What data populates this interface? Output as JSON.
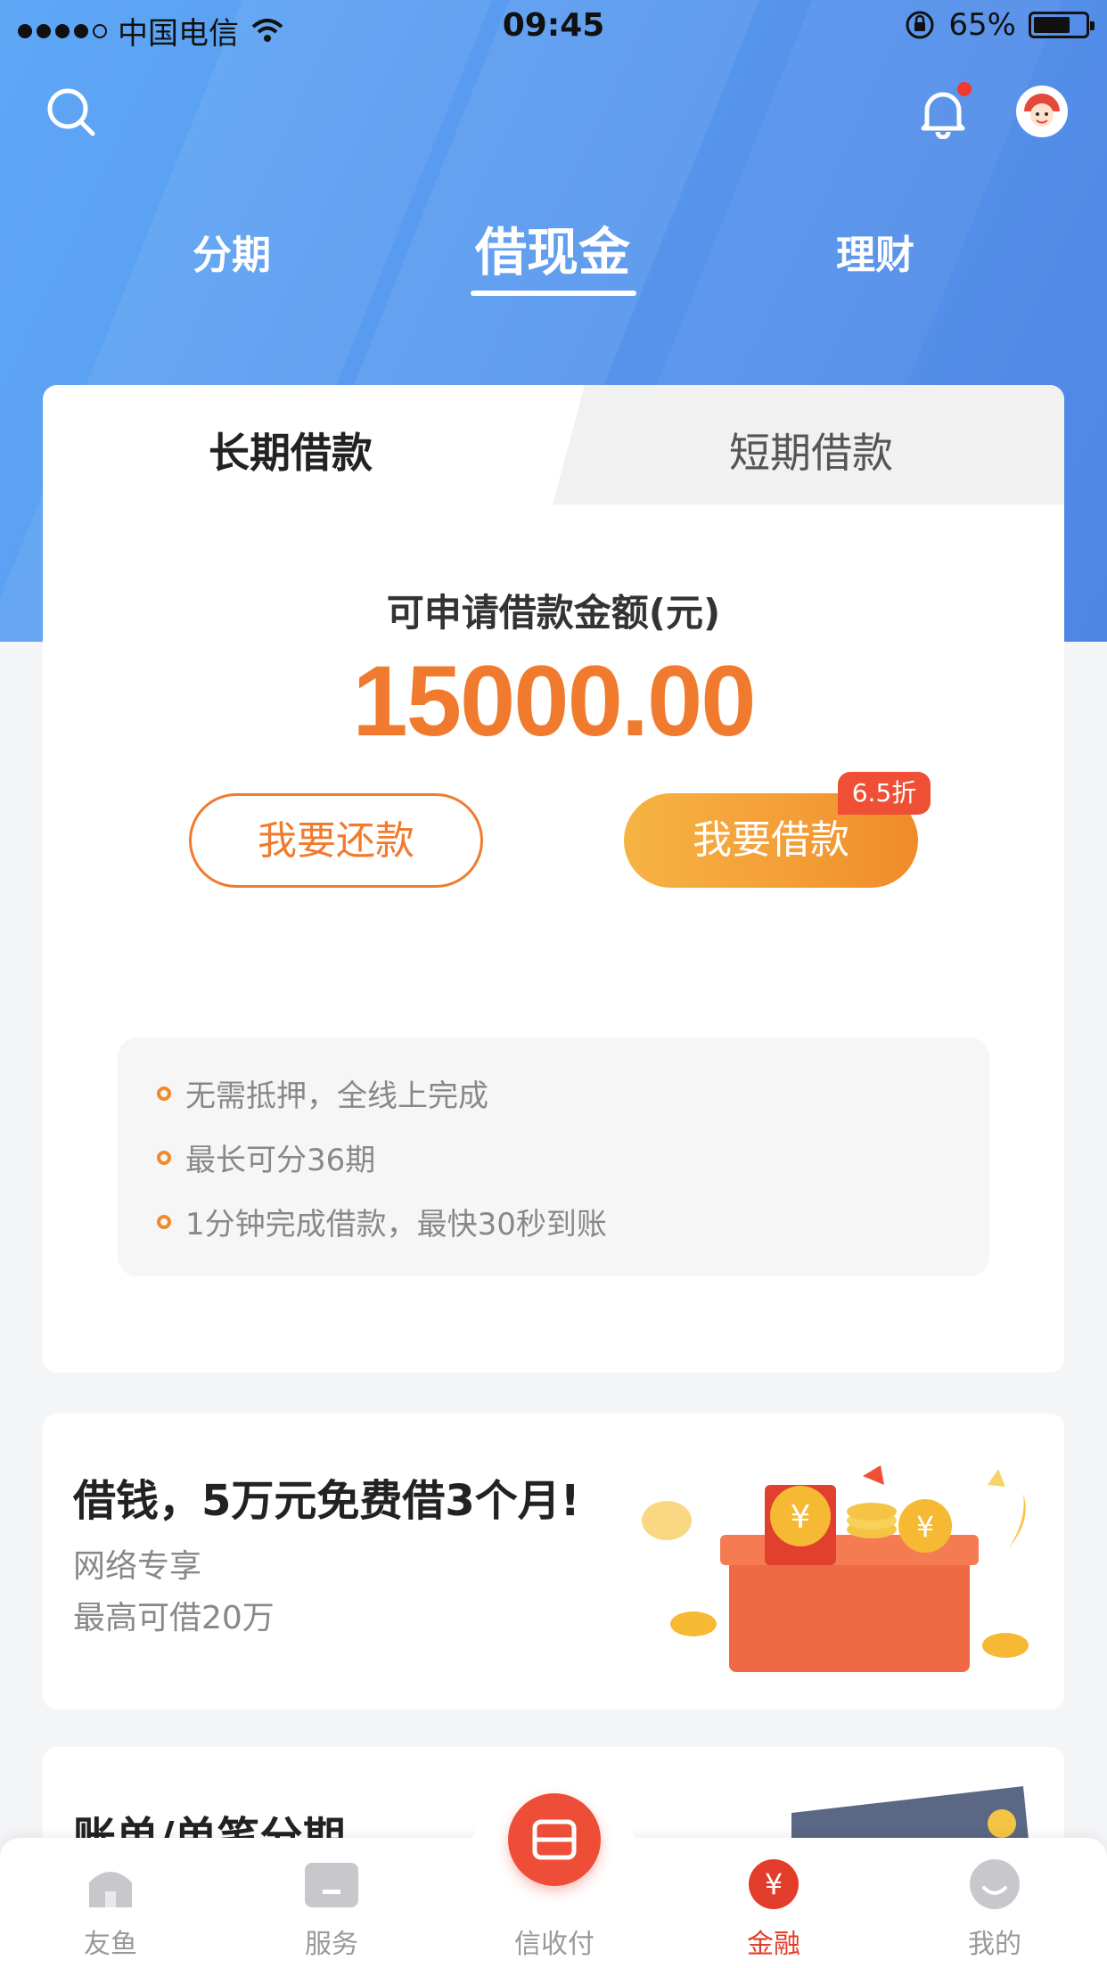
{
  "status_bar": {
    "carrier": "中国电信",
    "time": "09:45",
    "battery": "65%"
  },
  "header": {
    "tabs": [
      {
        "label": "分期"
      },
      {
        "label": "借现金"
      },
      {
        "label": "理财"
      }
    ],
    "active_tab": "借现金"
  },
  "loan_card": {
    "segments": {
      "active": "长期借款",
      "inactive": "短期借款"
    },
    "amount_label": "可申请借款金额(元)",
    "amount": "15000.00",
    "repay_button": "我要还款",
    "borrow_button": "我要借款",
    "discount_badge": "6.5折",
    "features": [
      "无需抵押，全线上完成",
      "最长可分36期",
      "1分钟完成借款，最快30秒到账"
    ]
  },
  "promo": {
    "title": "借钱，5万元免费借3个月!",
    "subtitle1": "网络专享",
    "subtitle2": "最高可借20万"
  },
  "card2": {
    "title": "账单/单笔分期"
  },
  "bottom_nav": {
    "items": [
      {
        "label": "友鱼"
      },
      {
        "label": "服务"
      },
      {
        "label": "信收付"
      },
      {
        "label": "金融"
      },
      {
        "label": "我的"
      }
    ],
    "active": "金融"
  },
  "colors": {
    "brand_blue": "#5898ee",
    "accent_orange": "#f07b2e",
    "badge_red": "#ef4f35",
    "nav_active": "#e23d2a"
  }
}
